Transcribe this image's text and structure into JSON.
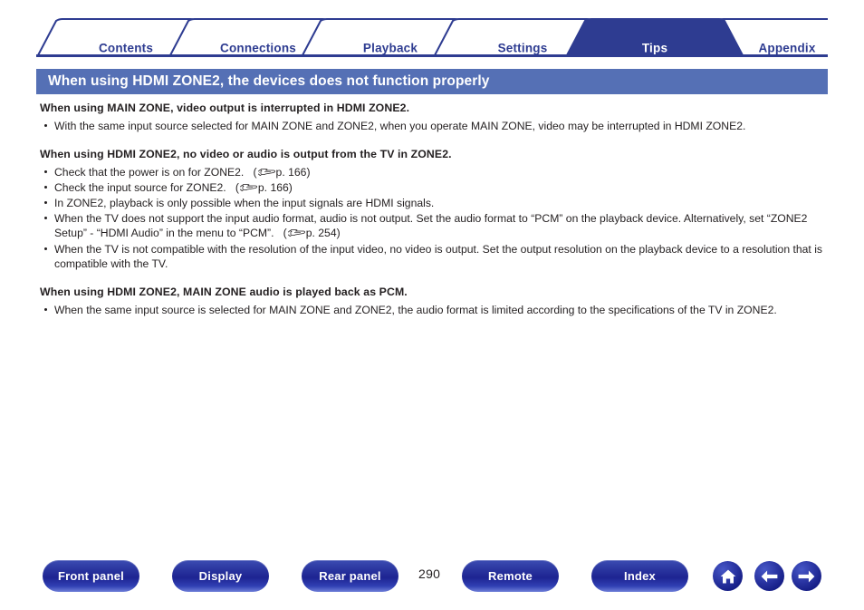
{
  "tabs": [
    {
      "label": "Contents",
      "active": false
    },
    {
      "label": "Connections",
      "active": false
    },
    {
      "label": "Playback",
      "active": false
    },
    {
      "label": "Settings",
      "active": false
    },
    {
      "label": "Tips",
      "active": true
    },
    {
      "label": "Appendix",
      "active": false
    }
  ],
  "title": "When using HDMI ZONE2, the devices does not function properly",
  "sections": [
    {
      "heading": "When using MAIN ZONE, video output is interrupted in HDMI ZONE2.",
      "items": [
        {
          "text": "With the same input source selected for MAIN ZONE and ZONE2, when you operate MAIN ZONE, video may be interrupted in HDMI ZONE2.",
          "ref": ""
        }
      ]
    },
    {
      "heading": "When using HDMI ZONE2, no video or audio is output from the TV in ZONE2.",
      "items": [
        {
          "text": "Check that the power is on for ZONE2.",
          "ref": "p. 166"
        },
        {
          "text": "Check the input source for ZONE2.",
          "ref": "p. 166"
        },
        {
          "text": "In ZONE2, playback is only possible when the input signals are HDMI signals.",
          "ref": ""
        },
        {
          "text": "When the TV does not support the input audio format, audio is not output. Set the audio format to “PCM” on the playback device. Alternatively, set “ZONE2 Setup” - “HDMI Audio” in the menu to “PCM”.",
          "ref": "p. 254"
        },
        {
          "text": "When the TV is not compatible with the resolution of the input video, no video is output. Set the output resolution on the playback device to a resolution that is compatible with the TV.",
          "ref": ""
        }
      ]
    },
    {
      "heading": "When using HDMI ZONE2, MAIN ZONE audio is played back as PCM.",
      "items": [
        {
          "text": "When the same input source is selected for MAIN ZONE and ZONE2, the audio format is limited according to the specifications of the TV in ZONE2.",
          "ref": ""
        }
      ]
    }
  ],
  "footer": {
    "buttons": [
      {
        "label": "Front panel"
      },
      {
        "label": "Display"
      },
      {
        "label": "Rear panel"
      },
      {
        "label": "Remote"
      },
      {
        "label": "Index"
      }
    ],
    "page_number": "290",
    "icon_buttons": [
      {
        "name": "home-icon"
      },
      {
        "name": "arrow-left-icon"
      },
      {
        "name": "arrow-right-icon"
      }
    ]
  },
  "colors": {
    "tab_blue": "#2e3c91",
    "title_bar": "#5570b5",
    "text": "#231f20"
  }
}
